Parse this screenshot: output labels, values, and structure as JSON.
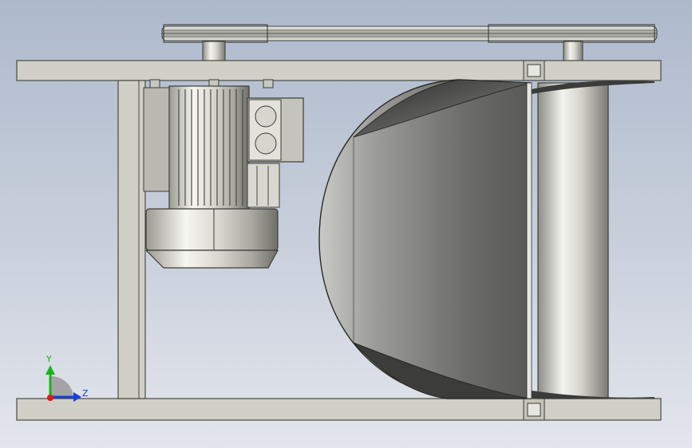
{
  "viewport": {
    "background_top": "#aeb9cc",
    "background_bottom": "#e3e6ec"
  },
  "model": {
    "frame_color": "#d0d0c6",
    "frame_stroke": "#4a4a44",
    "motor_color": "#dcdcd4",
    "drum_color": "#6f6f6f"
  },
  "triad": {
    "y_label": "Y",
    "z_label": "Z",
    "y_color": "#18b418",
    "z_color": "#1a3fd6",
    "x_color": "#e01818"
  }
}
